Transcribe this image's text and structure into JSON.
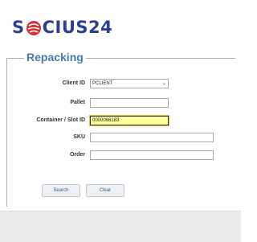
{
  "brand": {
    "prefix": "S",
    "suffix": "CIUS24"
  },
  "form": {
    "title": "Repacking",
    "client_id": {
      "label": "Client ID",
      "value": "PCLIENT"
    },
    "pallet": {
      "label": "Pallet",
      "value": ""
    },
    "container": {
      "label": "Container / Slot ID",
      "value": "0000066183"
    },
    "sku": {
      "label": "SKU",
      "value": ""
    },
    "order": {
      "label": "Order",
      "value": ""
    }
  },
  "buttons": {
    "search": "Search",
    "clear": "Clear"
  },
  "colors": {
    "brand": "#2b3e96",
    "logo_ball": "#d6313a",
    "title": "#4a78b4",
    "focus_bg": "#ffff99"
  }
}
